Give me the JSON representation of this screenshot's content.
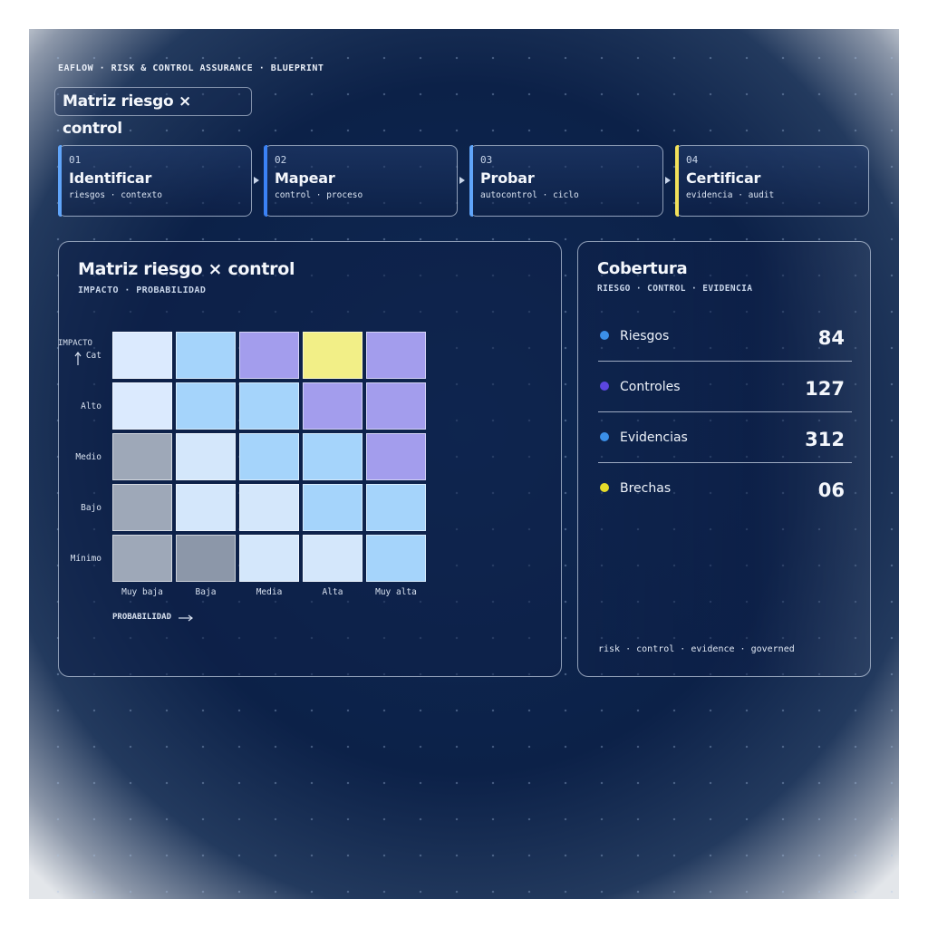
{
  "header": {
    "kicker": "EAFLOW · RISK & CONTROL ASSURANCE · BLUEPRINT",
    "title": "Matriz riesgo × control"
  },
  "steps": [
    {
      "num": "01",
      "title": "Identificar",
      "sub": "riesgos · contexto",
      "accent": "#60a5fa"
    },
    {
      "num": "02",
      "title": "Mapear",
      "sub": "control · proceso",
      "accent": "#3b82f6"
    },
    {
      "num": "03",
      "title": "Probar",
      "sub": "autocontrol · ciclo",
      "accent": "#60a5fa"
    },
    {
      "num": "04",
      "title": "Certificar",
      "sub": "evidencia · audit",
      "accent": "#f2e15a"
    }
  ],
  "matrix": {
    "title": "Matriz riesgo × control",
    "subtitle": "IMPACTO · PROBABILIDAD",
    "y_axis_label": "IMPACTO",
    "x_axis_label": "PROBABILIDAD",
    "rows": [
      "Cat",
      "Alto",
      "Medio",
      "Bajo",
      "Mínimo"
    ],
    "cols": [
      "Muy baja",
      "Baja",
      "Media",
      "Alta",
      "Muy alta"
    ],
    "cells": [
      [
        "#dbeafe",
        "#a5d4fb",
        "#a39ded",
        "#f2ef87",
        "#a39ded"
      ],
      [
        "#dbeafe",
        "#a5d4fb",
        "#a5d4fb",
        "#a39ded",
        "#a39ded"
      ],
      [
        "#9ea8b8",
        "#d4e7fb",
        "#a5d4fb",
        "#a5d4fb",
        "#a39ded"
      ],
      [
        "#9ea8b8",
        "#d4e7fb",
        "#d4e7fb",
        "#a5d4fb",
        "#a5d4fb"
      ],
      [
        "#9ea8b8",
        "#8c97a9",
        "#d4e7fb",
        "#d4e7fb",
        "#a5d4fb"
      ]
    ]
  },
  "coverage": {
    "title": "Cobertura",
    "subtitle": "RIESGO · CONTROL · EVIDENCIA",
    "metrics": [
      {
        "label": "Riesgos",
        "value": "84",
        "color": "#3b8fe8"
      },
      {
        "label": "Controles",
        "value": "127",
        "color": "#5b46e0"
      },
      {
        "label": "Evidencias",
        "value": "312",
        "color": "#3b8fe8"
      },
      {
        "label": "Brechas",
        "value": "06",
        "color": "#e6dc2a"
      }
    ],
    "footer": "risk · control · evidence · governed"
  }
}
